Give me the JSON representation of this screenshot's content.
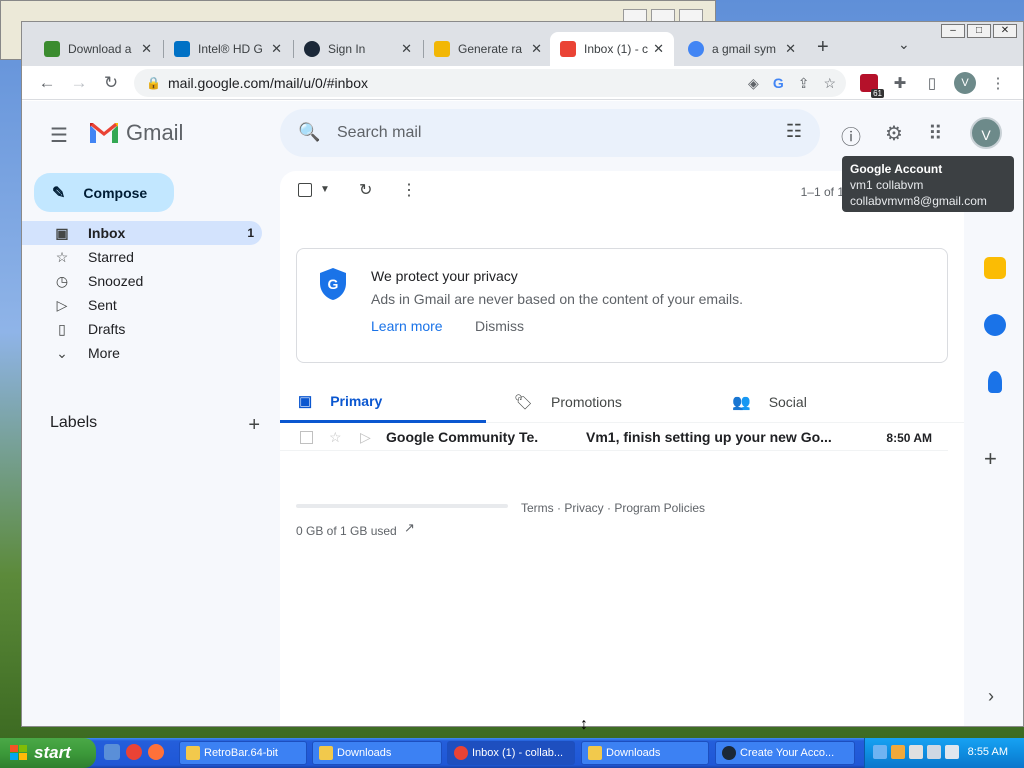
{
  "browser": {
    "tabs": [
      {
        "title": "Download a",
        "favicon_color": "#3b8c2f"
      },
      {
        "title": "Intel® HD G",
        "favicon_color": "#0071c5"
      },
      {
        "title": "Sign In",
        "favicon_color": "#1b2838"
      },
      {
        "title": "Generate ra",
        "favicon_color": "#f2b705"
      },
      {
        "title": "Inbox (1) - c",
        "favicon_color": "#ea4335",
        "active": true
      },
      {
        "title": "a gmail sym",
        "favicon_color": "#4285f4"
      }
    ],
    "new_tab": "+",
    "tab_menu": "⌄",
    "url": "mail.google.com/mail/u/0/#inbox",
    "profile_initial": "V",
    "extension_badge_count": "61"
  },
  "gmail": {
    "brand": "Gmail",
    "search_placeholder": "Search mail",
    "compose_label": "Compose",
    "nav": [
      {
        "label": "Inbox",
        "icon": "inbox-icon",
        "glyph": "▣",
        "count": "1",
        "active": true
      },
      {
        "label": "Starred",
        "icon": "star-icon",
        "glyph": "☆",
        "count": ""
      },
      {
        "label": "Snoozed",
        "icon": "clock-icon",
        "glyph": "◷",
        "count": ""
      },
      {
        "label": "Sent",
        "icon": "send-icon",
        "glyph": "▷",
        "count": ""
      },
      {
        "label": "Drafts",
        "icon": "draft-icon",
        "glyph": "▯",
        "count": ""
      },
      {
        "label": "More",
        "icon": "chevron-down-icon",
        "glyph": "⌄",
        "count": ""
      }
    ],
    "labels_heading": "Labels",
    "pager": "1–1 of 1",
    "privacy": {
      "title": "We protect your privacy",
      "body": "Ads in Gmail are never based on the content of your emails.",
      "learn_more": "Learn more",
      "dismiss": "Dismiss"
    },
    "inbox_tabs": [
      {
        "label": "Primary",
        "icon": "inbox-icon",
        "glyph": "▣",
        "active": true
      },
      {
        "label": "Promotions",
        "icon": "tag-icon",
        "glyph": "🏷",
        "active": false
      },
      {
        "label": "Social",
        "icon": "people-icon",
        "glyph": "👥",
        "active": false
      }
    ],
    "emails": [
      {
        "from": "Google Community Te.",
        "subject": "Vm1, finish setting up your new Go...",
        "time": "8:50 AM",
        "unread": true
      }
    ],
    "footer": {
      "links": "Terms · Privacy · Program Policies",
      "storage": "0 GB of 1 GB used",
      "storage_fraction": 0.0
    },
    "account_tooltip": {
      "title": "Google Account",
      "name": "vm1 collabvm",
      "email": "collabvmvm8@gmail.com"
    },
    "avatar_initial": "V"
  },
  "taskbar": {
    "start_label": "start",
    "buttons": [
      {
        "label": "RetroBar.64-bit",
        "color": "#f2c94c"
      },
      {
        "label": "Downloads",
        "color": "#f2c94c"
      },
      {
        "label": "Inbox (1) - collab...",
        "color": "#ea4335",
        "active": true
      },
      {
        "label": "Downloads",
        "color": "#f2c94c"
      },
      {
        "label": "Create Your Acco...",
        "color": "#1b2838"
      }
    ],
    "clock": "8:55 AM"
  },
  "colors": {
    "gmail_accent": "#0b57d0",
    "compose_bg": "#c2e7ff",
    "selected_nav_bg": "#d3e3fd"
  }
}
